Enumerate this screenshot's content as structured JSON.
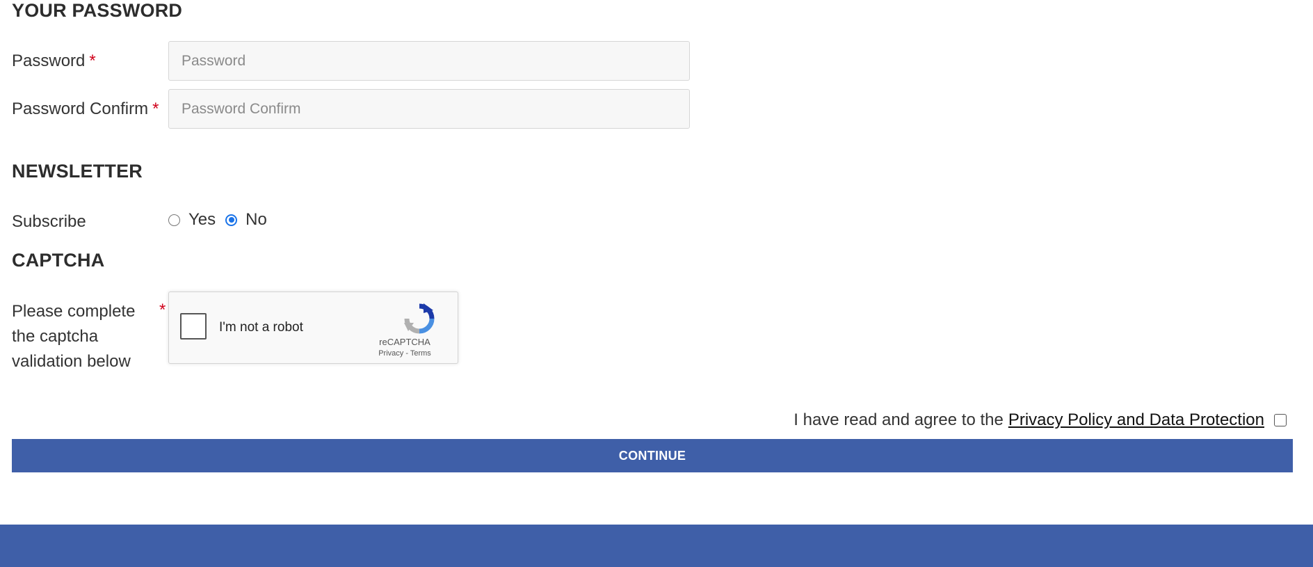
{
  "password_section": {
    "title": "YOUR PASSWORD",
    "password_label": "Password",
    "password_placeholder": "Password",
    "confirm_label": "Password Confirm",
    "confirm_placeholder": "Password Confirm",
    "required_marker": "*"
  },
  "newsletter_section": {
    "title": "NEWSLETTER",
    "subscribe_label": "Subscribe",
    "options": [
      {
        "label": "Yes",
        "selected": false
      },
      {
        "label": "No",
        "selected": true
      }
    ]
  },
  "captcha_section": {
    "title": "CAPTCHA",
    "label": "Please complete the captcha validation below",
    "required_marker": "*",
    "widget": {
      "checkbox_text": "I'm not a robot",
      "brand": "reCAPTCHA",
      "links": "Privacy - Terms",
      "checked": false
    }
  },
  "agreement": {
    "prefix": "I have read and agree to the",
    "link_text": "Privacy Policy and Data Protection",
    "checked": false
  },
  "continue_button": {
    "label": "CONTINUE"
  },
  "colors": {
    "accent": "#3f5fa8",
    "required": "#d0021b",
    "radio_selected": "#1a73e8"
  }
}
